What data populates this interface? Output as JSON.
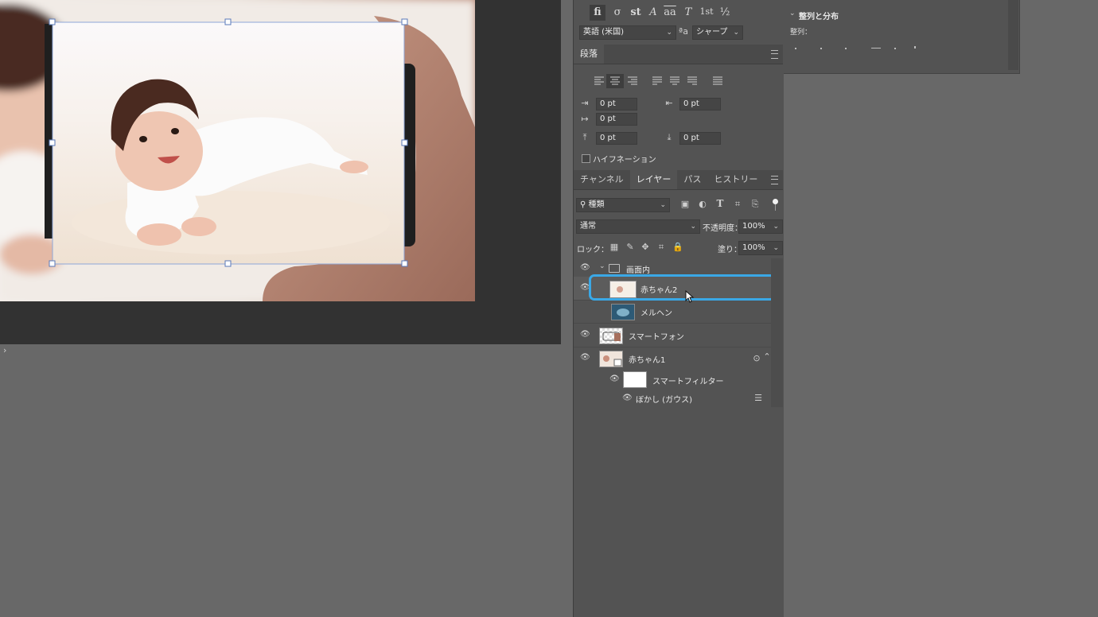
{
  "colors": {
    "workspace": "#686868",
    "canvas_bg": "#323232",
    "panel_bg": "#535353",
    "selection_highlight": "#3aa8e6",
    "transform_box": "#8fa7d8"
  },
  "canvas": {
    "expand_glyph": "›"
  },
  "character_panel": {
    "glyphs": [
      "fi",
      "σ",
      "st",
      "A",
      "aa",
      "T",
      "1st",
      "½"
    ],
    "language": "英語 (米国)",
    "aa_icon": "aa-icon",
    "anti_alias": "シャープ"
  },
  "paragraph_panel": {
    "title": "段落",
    "indent_left": "0 pt",
    "indent_right": "0 pt",
    "indent_first": "0 pt",
    "space_before": "0 pt",
    "space_after": "0 pt",
    "hyphenation_label": "ハイフネーション",
    "hyphenation_checked": false
  },
  "layers_panel": {
    "tabs": [
      "チャンネル",
      "レイヤー",
      "パス",
      "ヒストリー"
    ],
    "active_tab": 1,
    "filter_kind": "種類",
    "blend_mode": "通常",
    "opacity_label": "不透明度：",
    "opacity_value": "100%",
    "lock_label": "ロック：",
    "fill_label": "塗り：",
    "fill_value": "100%",
    "layers": [
      {
        "name": "画面内",
        "type": "group",
        "visible": true
      },
      {
        "name": "赤ちゃん2",
        "type": "layer",
        "visible": true,
        "selected": true
      },
      {
        "name": "メルヘン",
        "type": "layer",
        "visible": false
      },
      {
        "name": "スマートフォン",
        "type": "layer",
        "visible": true
      },
      {
        "name": "赤ちゃん1",
        "type": "smart-object",
        "visible": true
      },
      {
        "name": "スマートフィルター",
        "type": "smart-filter",
        "visible": true
      },
      {
        "name": "ぼかし (ガウス)",
        "type": "filter",
        "visible": true
      }
    ]
  },
  "align_panel": {
    "title": "整列と分布",
    "align_label": "整列："
  }
}
